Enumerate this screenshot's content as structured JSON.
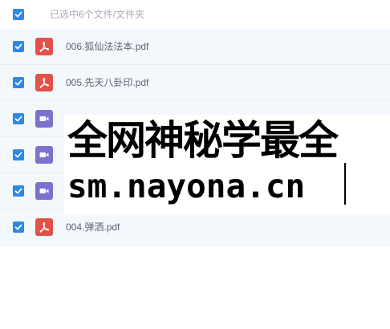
{
  "header": {
    "selection_text": "已选中6个文件/文件夹"
  },
  "files": [
    {
      "name": "006.狐仙法法本.pdf",
      "type": "pdf",
      "icon": "pdf-icon",
      "checked": true
    },
    {
      "name": "005.先天八卦印.pdf",
      "type": "pdf",
      "icon": "pdf-icon",
      "checked": true
    },
    {
      "name": "",
      "type": "video",
      "icon": "video-icon",
      "checked": true
    },
    {
      "name": "",
      "type": "video",
      "icon": "video-icon",
      "checked": true
    },
    {
      "name": "",
      "type": "video",
      "icon": "video-icon",
      "checked": true
    },
    {
      "name": "004.弹洒.pdf",
      "type": "pdf",
      "icon": "pdf-icon",
      "checked": true
    }
  ],
  "overlay": {
    "line1": "全网神秘学最全",
    "line2": "sm.nayona.cn"
  },
  "colors": {
    "accent": "#2d88e6",
    "pdf": "#e3514b",
    "video": "#7a72cf",
    "row_bg": "#f3f8fd"
  }
}
